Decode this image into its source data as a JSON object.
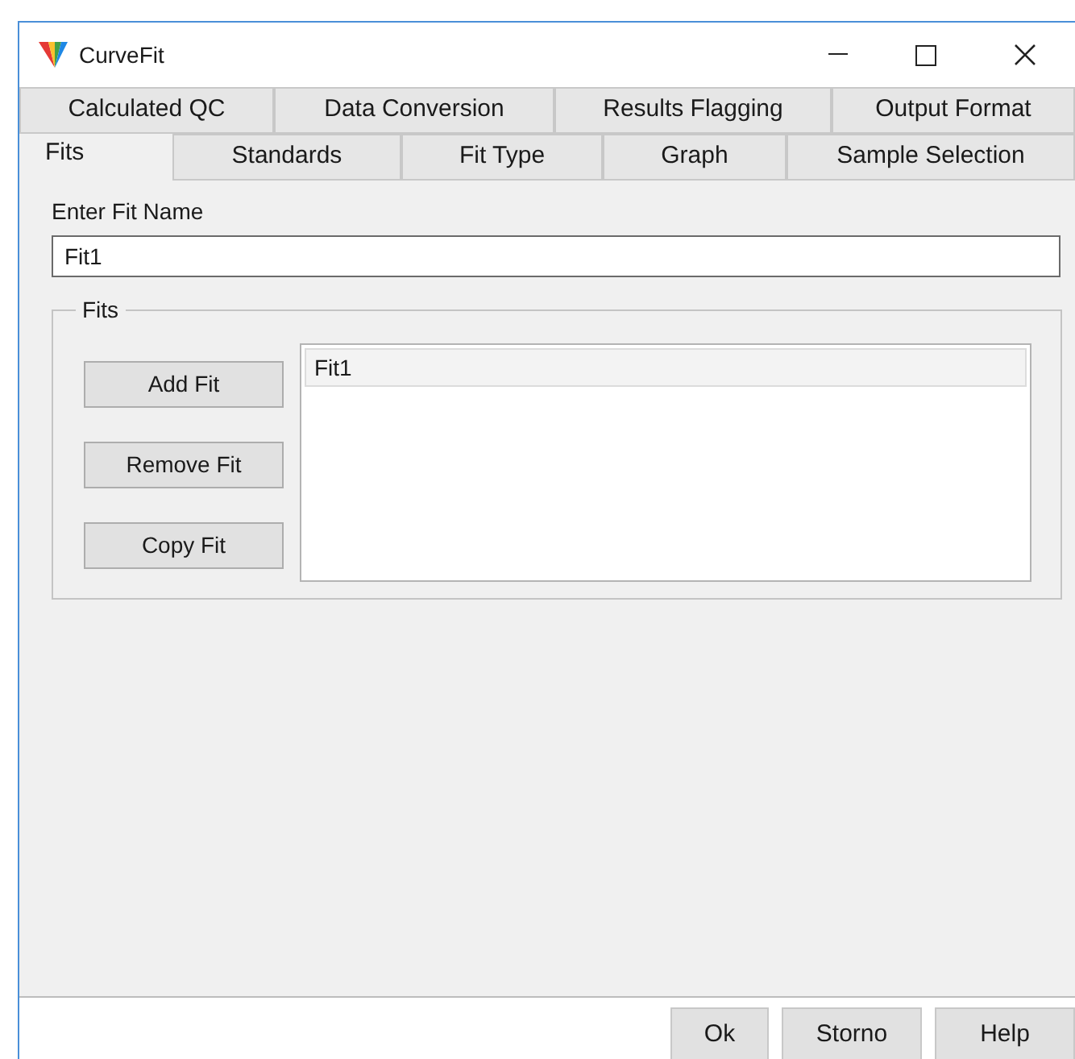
{
  "window": {
    "title": "CurveFit"
  },
  "tab_rows": [
    [
      {
        "label": "Calculated QC",
        "selected": false
      },
      {
        "label": "Data Conversion",
        "selected": false
      },
      {
        "label": "Results Flagging",
        "selected": false
      },
      {
        "label": "Output Format",
        "selected": false
      }
    ],
    [
      {
        "label": "Fits",
        "selected": true
      },
      {
        "label": "Standards",
        "selected": false
      },
      {
        "label": "Fit Type",
        "selected": false
      },
      {
        "label": "Graph",
        "selected": false
      },
      {
        "label": "Sample Selection",
        "selected": false
      }
    ]
  ],
  "fit_name": {
    "label": "Enter Fit Name",
    "value": "Fit1"
  },
  "fits_group": {
    "title": "Fits",
    "buttons": [
      "Add Fit",
      "Remove Fit",
      "Copy Fit"
    ],
    "list": [
      {
        "label": "Fit1",
        "selected": true
      }
    ]
  },
  "footer_buttons": [
    "Ok",
    "Storno",
    "Help"
  ]
}
